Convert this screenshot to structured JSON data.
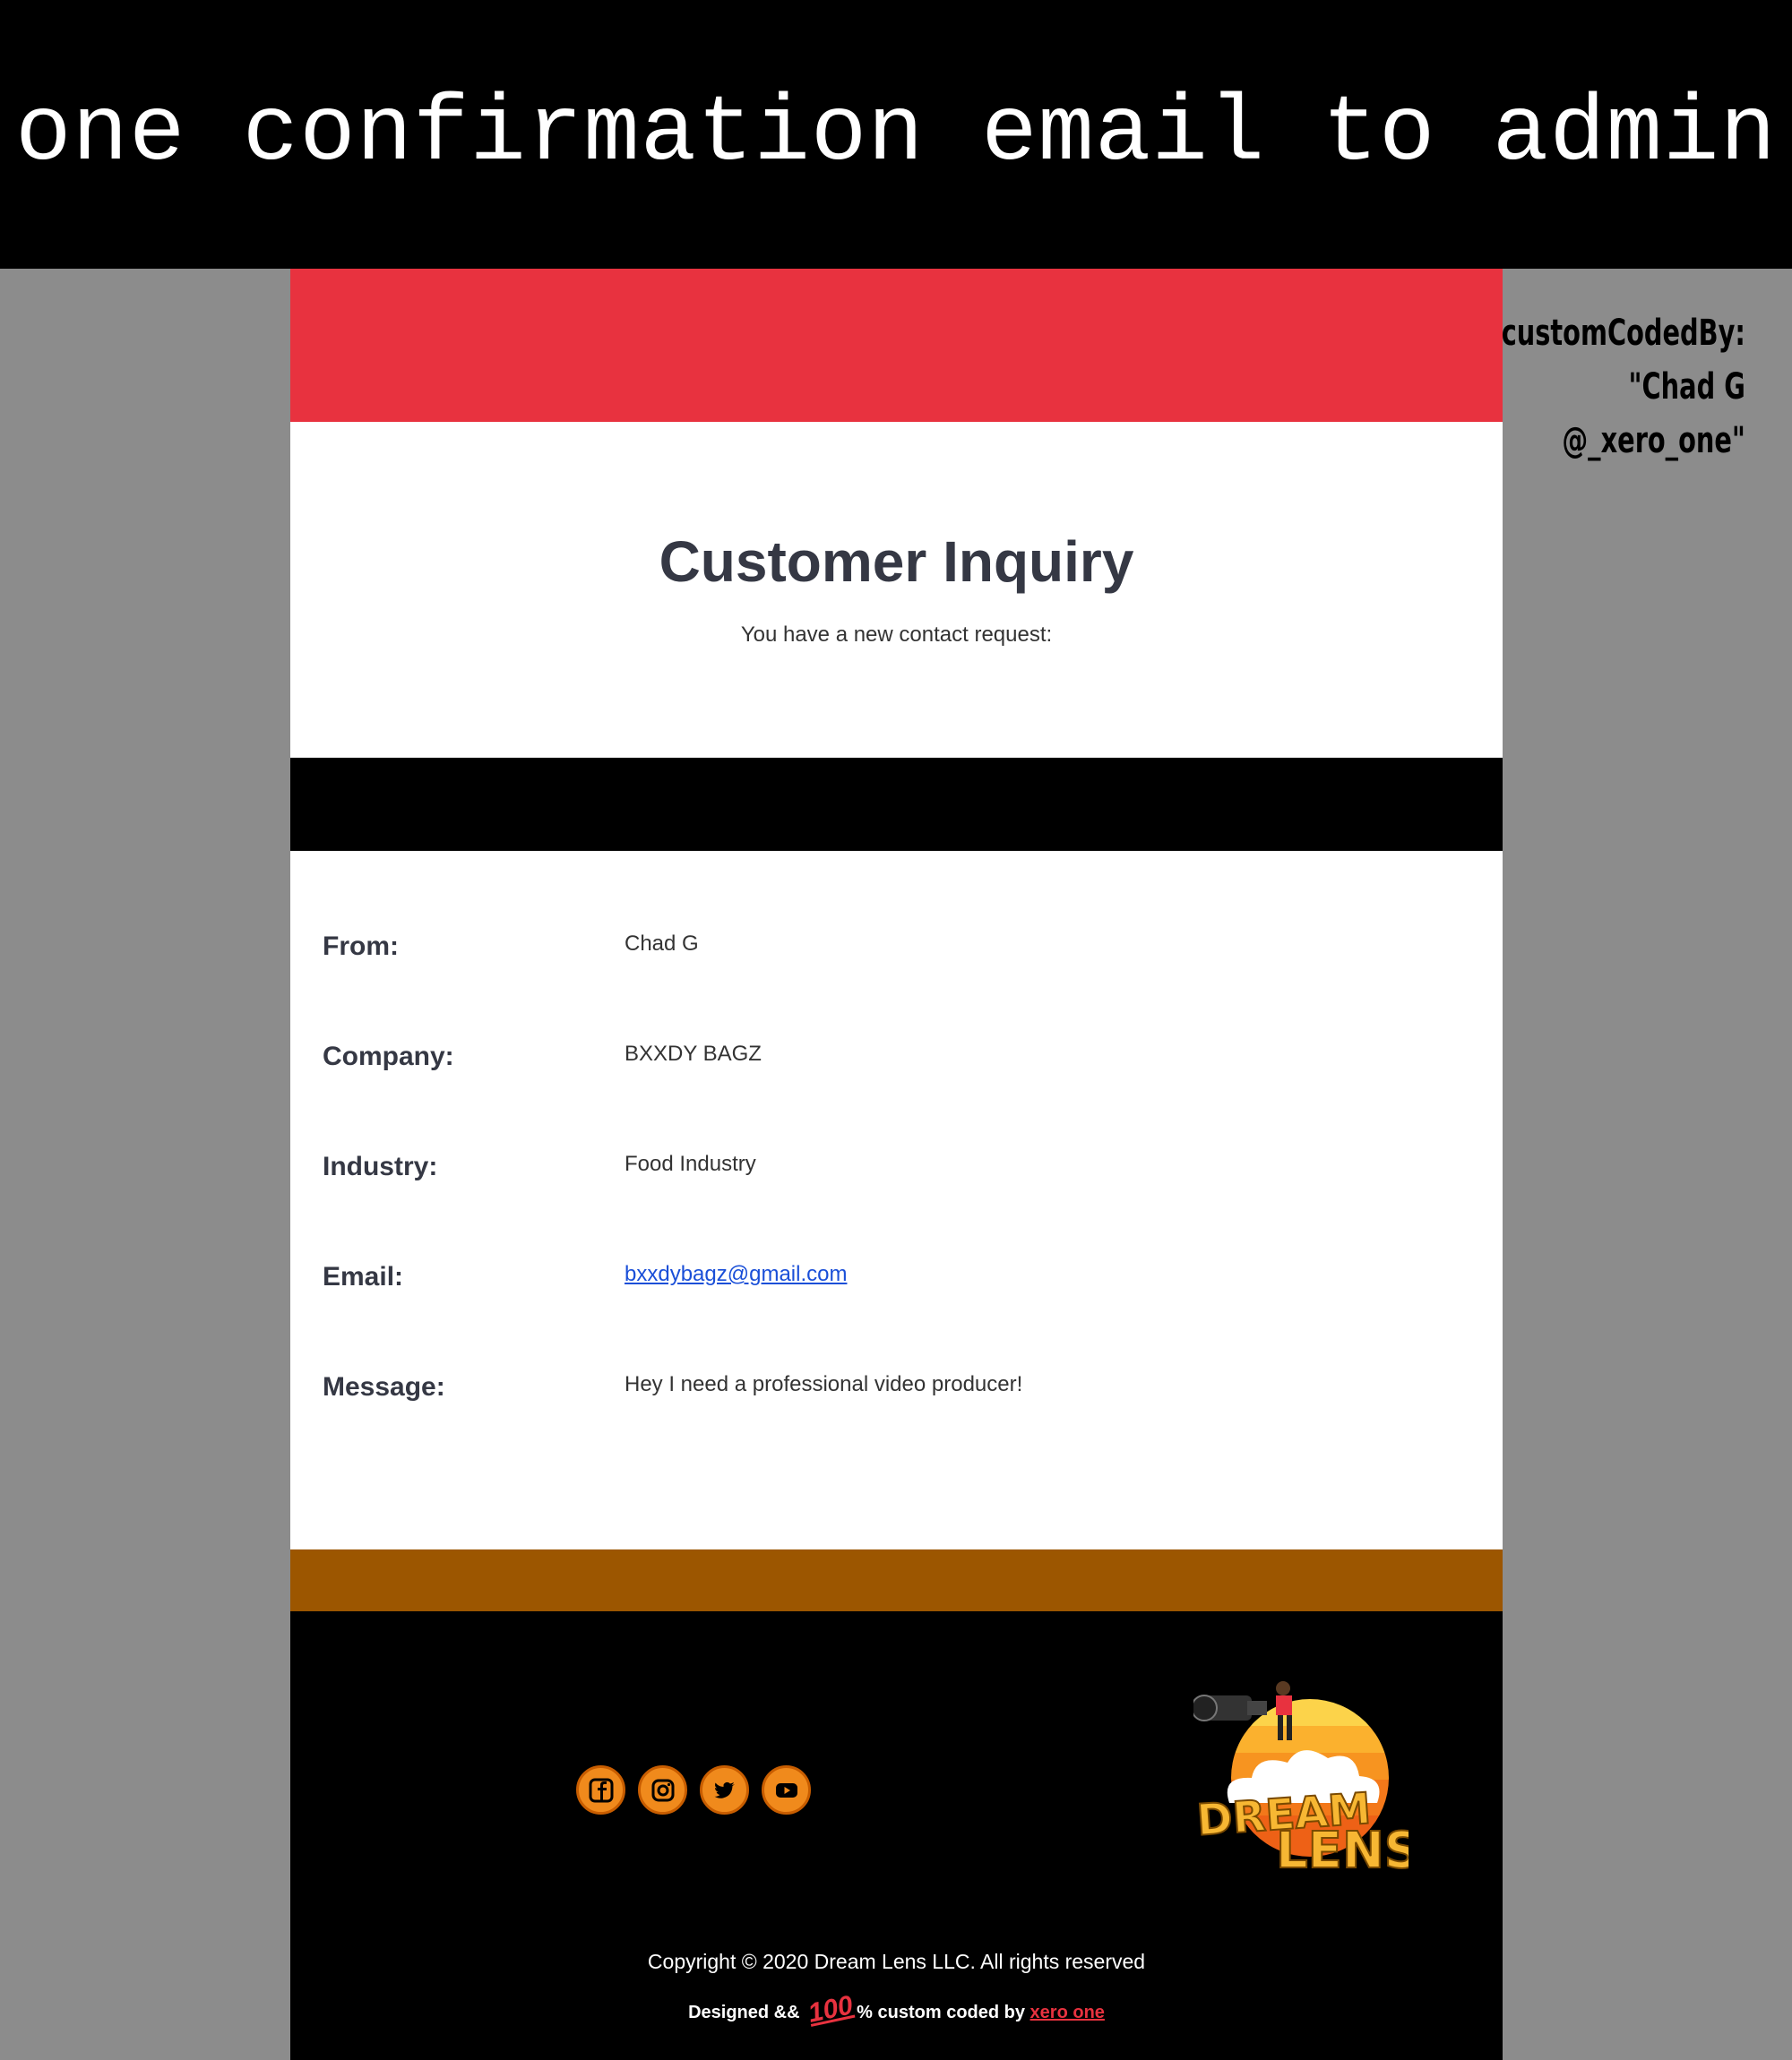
{
  "banner": {
    "title": "one confirmation email to admin"
  },
  "credit": {
    "line1": "$customCodedBy:",
    "line2": "\"Chad G",
    "line3": "@_xero_one\""
  },
  "email": {
    "heading": "Customer Inquiry",
    "subheading": "You have a new contact request:",
    "fields": [
      {
        "label": "From:",
        "value": "Chad G"
      },
      {
        "label": "Company:",
        "value": "BXXDY BAGZ"
      },
      {
        "label": "Industry:",
        "value": "Food Industry"
      },
      {
        "label": "Email:",
        "value": "bxxdybagz@gmail.com"
      },
      {
        "label": "Message:",
        "value": "Hey I need a professional video producer!"
      }
    ],
    "colors": {
      "accent_red": "#e8323f",
      "band_brown": "#9c5600",
      "icon_orange": "#f08a1c"
    }
  },
  "footer": {
    "social_icons": [
      "facebook-icon",
      "instagram-icon",
      "twitter-icon",
      "youtube-icon"
    ],
    "logo_text": {
      "line1": "DREAM",
      "line2": "LENS"
    },
    "copyright": "Copyright © 2020 Dream Lens LLC. All rights reserved",
    "designed_prefix": "Designed &&",
    "designed_emoji": "100",
    "designed_middle": "% custom coded by",
    "designed_link": "xero one"
  }
}
